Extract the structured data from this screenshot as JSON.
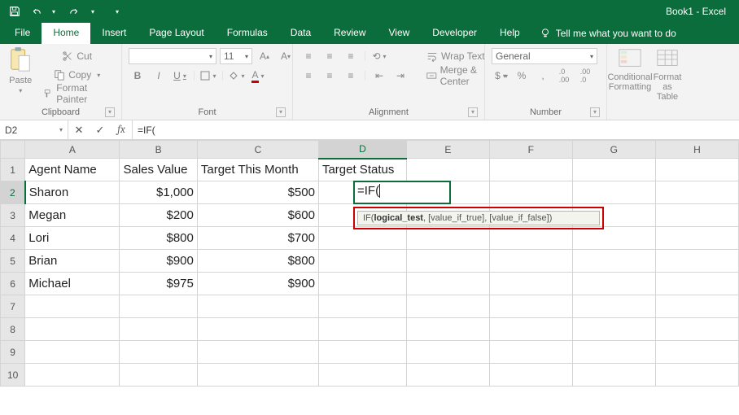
{
  "app": {
    "title": "Book1 - Excel"
  },
  "tabs": {
    "file": "File",
    "home": "Home",
    "insert": "Insert",
    "page_layout": "Page Layout",
    "formulas": "Formulas",
    "data": "Data",
    "review": "Review",
    "view": "View",
    "developer": "Developer",
    "help": "Help",
    "tell_me": "Tell me what you want to do"
  },
  "ribbon": {
    "clipboard": {
      "label": "Clipboard",
      "paste": "Paste",
      "cut": "Cut",
      "copy": "Copy",
      "format_painter": "Format Painter"
    },
    "font": {
      "label": "Font",
      "name": "",
      "size": "11",
      "bold": "B",
      "italic": "I",
      "underline": "U"
    },
    "alignment": {
      "label": "Alignment",
      "wrap": "Wrap Text",
      "merge": "Merge & Center"
    },
    "number": {
      "label": "Number",
      "format": "General",
      "currency": "$",
      "percent": "%",
      "comma": ",",
      "inc": ".0→.00",
      "dec": ".00→.0"
    },
    "styles": {
      "cond": "Conditional Formatting",
      "table": "Format as Table"
    }
  },
  "formula_bar": {
    "name_box": "D2",
    "cancel": "✕",
    "enter": "✓",
    "fx": "fx",
    "formula": "=IF("
  },
  "columns": [
    "A",
    "B",
    "C",
    "D",
    "E",
    "F",
    "G",
    "H"
  ],
  "active": {
    "col": "D",
    "row": 2
  },
  "headers": {
    "A": "Agent Name",
    "B": "Sales Value",
    "C": "Target This Month",
    "D": "Target Status"
  },
  "rows": [
    {
      "A": "Sharon",
      "B": "$1,000",
      "C": "$500",
      "D": "=IF("
    },
    {
      "A": "Megan",
      "B": "$200",
      "C": "$600",
      "D": ""
    },
    {
      "A": "Lori",
      "B": "$800",
      "C": "$700",
      "D": ""
    },
    {
      "A": "Brian",
      "B": "$900",
      "C": "$800",
      "D": ""
    },
    {
      "A": "Michael",
      "B": "$975",
      "C": "$900",
      "D": ""
    }
  ],
  "cell_edit": {
    "value": "=IF("
  },
  "tooltip": {
    "fn": "IF(",
    "arg_bold": "logical_test",
    "rest": ", [value_if_true], [value_if_false])"
  }
}
